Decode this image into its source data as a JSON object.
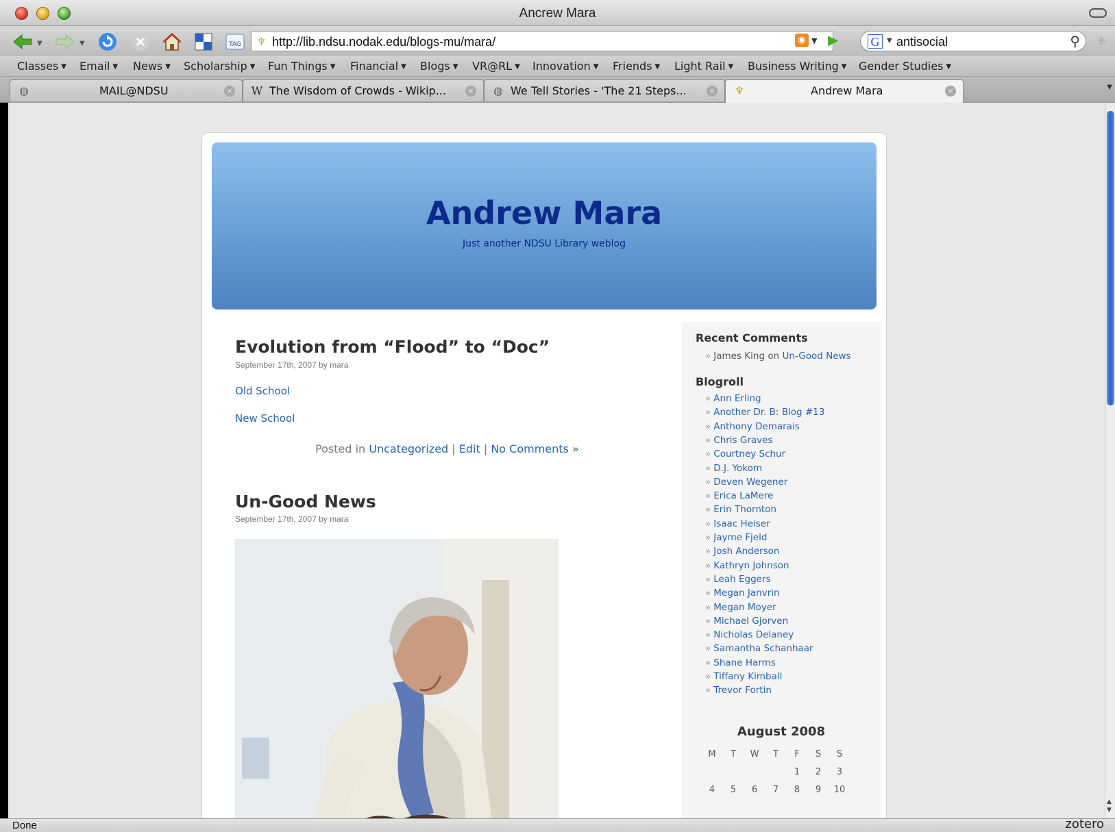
{
  "window": {
    "title": "Ancrew Mara"
  },
  "toolbar": {
    "url": "http://lib.ndsu.nodak.edu/blogs-mu/mara/",
    "search_text": "antisocial",
    "tag_label": "TAG"
  },
  "bookmarks": [
    "Classes",
    "Email",
    "News",
    "Scholarship",
    "Fun Things",
    "Financial",
    "Blogs",
    "VR@RL",
    "Innovation",
    "Friends",
    "Light Rail",
    "Business Writing",
    "Gender Studies"
  ],
  "tabs": [
    {
      "label": "MAIL@NDSU",
      "icon": "globe-icon",
      "active": false
    },
    {
      "label": "The Wisdom of Crowds - Wikip...",
      "icon": "wikipedia-icon",
      "active": false
    },
    {
      "label": "We Tell Stories - 'The 21 Steps...",
      "icon": "globe-icon",
      "active": false
    },
    {
      "label": "Andrew Mara",
      "icon": "ndsu-icon",
      "active": true
    }
  ],
  "blog": {
    "title": "Andrew Mara",
    "description": "Just another NDSU Library weblog"
  },
  "posts": [
    {
      "title": "Evolution from “Flood” to “Doc”",
      "meta": "September 17th, 2007 by mara",
      "links": [
        "Old School",
        "New School"
      ],
      "footer": {
        "posted_in": "Posted in",
        "category": "Uncategorized",
        "sep1": "|",
        "edit": "Edit",
        "sep2": "|",
        "comments": "No Comments »"
      }
    },
    {
      "title": "Un-Good News",
      "meta": "September 17th, 2007 by mara"
    }
  ],
  "sidebar": {
    "recent_comments_title": "Recent Comments",
    "recent_comment": {
      "author": "James King",
      "on": "on",
      "post": "Un-Good News"
    },
    "blogroll_title": "Blogroll",
    "blogroll": [
      "Ann Erling",
      "Another Dr. B: Blog #13",
      "Anthony Demarais",
      "Chris Graves",
      "Courtney Schur",
      "D.J. Yokom",
      "Deven Wegener",
      "Erica LaMere",
      "Erin Thornton",
      "Isaac Heiser",
      "Jayme Fjeld",
      "Josh Anderson",
      "Kathryn Johnson",
      "Leah Eggers",
      "Megan Janvrin",
      "Megan Moyer",
      "Michael Gjorven",
      "Nicholas Delaney",
      "Samantha Schanhaar",
      "Shane Harms",
      "Tiffany Kimball",
      "Trevor Fortin"
    ],
    "calendar": {
      "title": "August 2008",
      "days": [
        "M",
        "T",
        "W",
        "T",
        "F",
        "S",
        "S"
      ],
      "row1": [
        "1",
        "2",
        "3"
      ],
      "row2": [
        "4",
        "5",
        "6",
        "7",
        "8",
        "9",
        "10"
      ]
    }
  },
  "status": {
    "text": "Done",
    "addon": "zotero"
  },
  "colors": {
    "link": "#2a62b3",
    "header_blue": "#5e94cf",
    "title_navy": "#0d2a8a"
  }
}
